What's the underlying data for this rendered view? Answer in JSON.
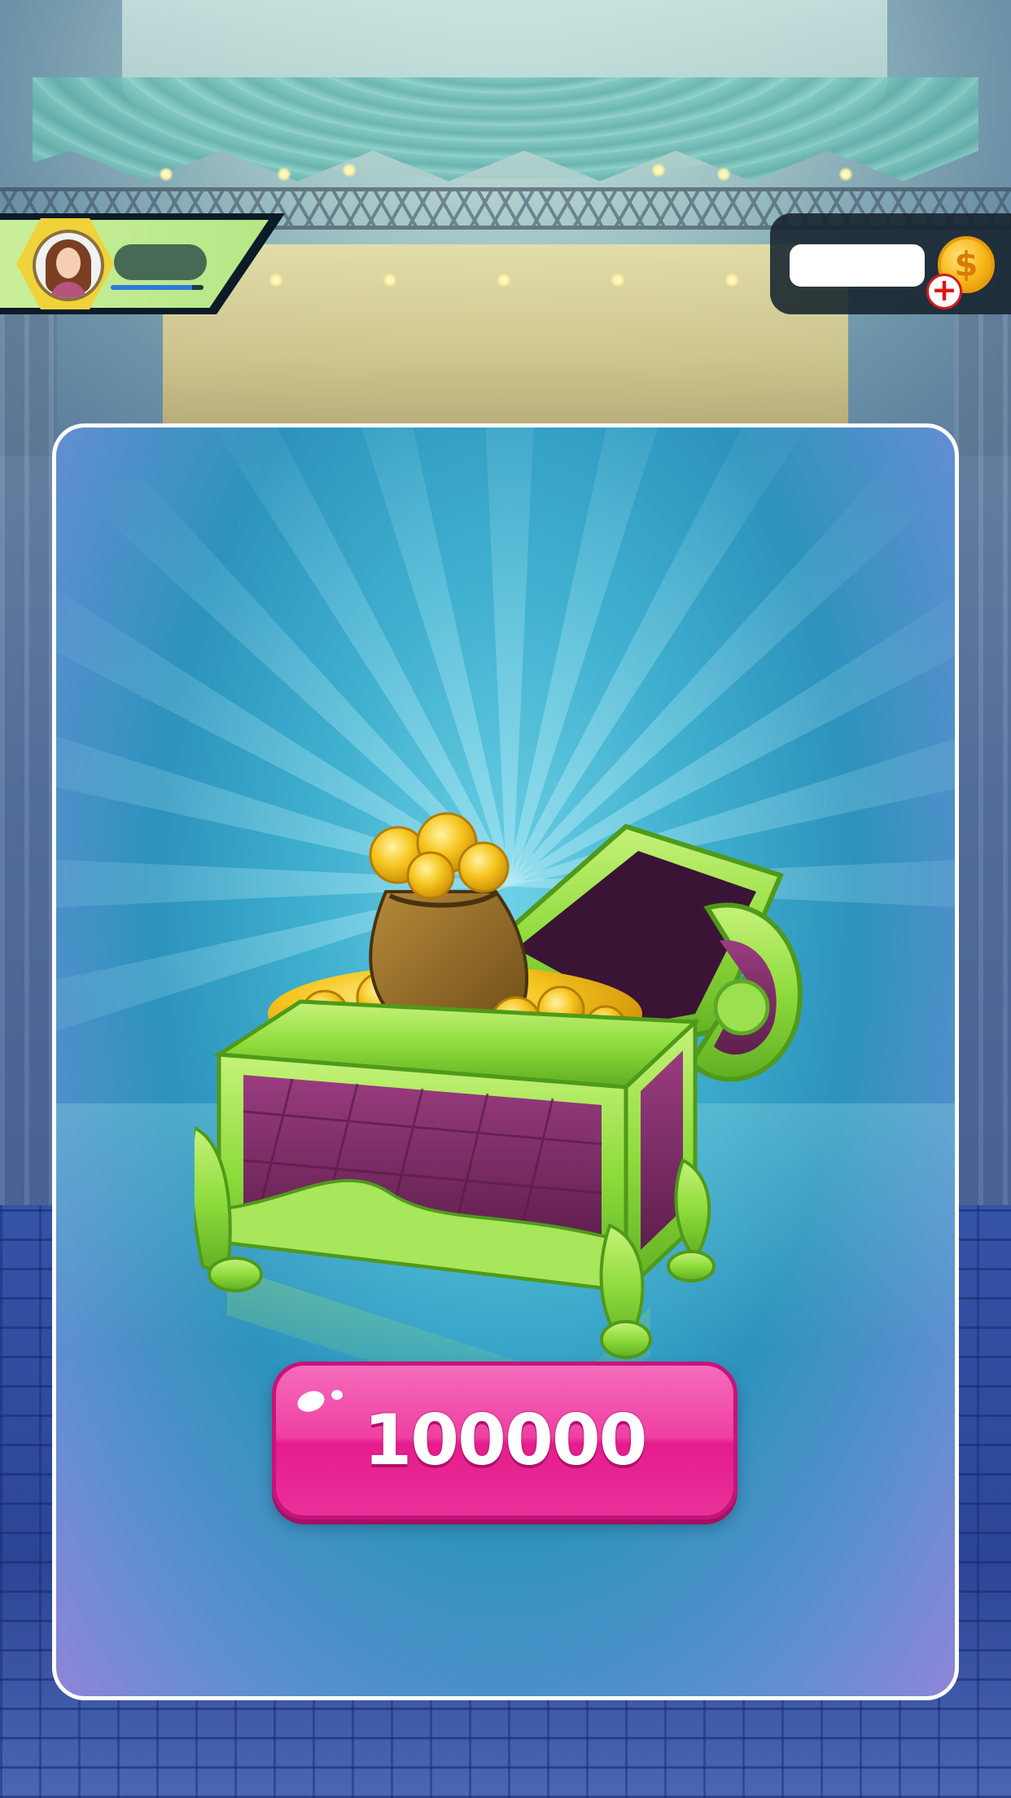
{
  "player_bar": {
    "avatar": "female-player-avatar",
    "xp_progress": 0.88
  },
  "wallet": {
    "coin_icon": "dollar-coin-icon",
    "add_icon": "red-plus-icon",
    "coin_symbol": "$",
    "add_symbol": "+"
  },
  "offer": {
    "item": "treasure-chest-of-coins",
    "price": "100000"
  },
  "colors": {
    "price_button": "#ec3a9e",
    "card_border": "#ffffff",
    "chest_green": "#8fdc3c",
    "chest_purple": "#7a2a63",
    "coin_gold": "#f6b516"
  }
}
